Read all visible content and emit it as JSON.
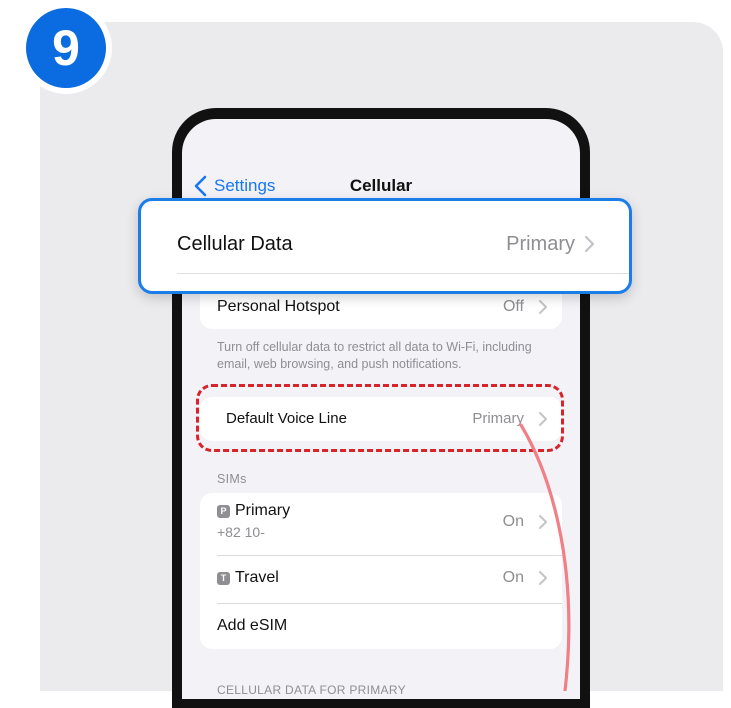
{
  "step": {
    "number": "9"
  },
  "nav": {
    "back_label": "Settings",
    "title": "Cellular"
  },
  "highlight": {
    "label": "Cellular Data",
    "value": "Primary"
  },
  "rows": {
    "personal_hotspot": {
      "label": "Personal Hotspot",
      "value": "Off"
    },
    "footnote": "Turn off cellular data to restrict all data to Wi-Fi, including email, web browsing, and push notifications.",
    "default_voice_line": {
      "label": "Default Voice Line",
      "value": "Primary"
    }
  },
  "sims": {
    "header": "SIMs",
    "items": [
      {
        "badge": "P",
        "name": "Primary",
        "number": "+82 10-",
        "status": "On"
      },
      {
        "badge": "T",
        "name": "Travel",
        "status": "On"
      }
    ],
    "add_label": "Add eSIM"
  },
  "section_cut": "CELLULAR DATA FOR PRIMARY",
  "colors": {
    "accent": "#0a6ce0",
    "link": "#1877f2",
    "annotation_red": "#d8232a",
    "arrow_pink": "#f07f86"
  },
  "icons": {
    "back": "chevron-left-icon",
    "disclosure": "chevron-right-icon"
  }
}
